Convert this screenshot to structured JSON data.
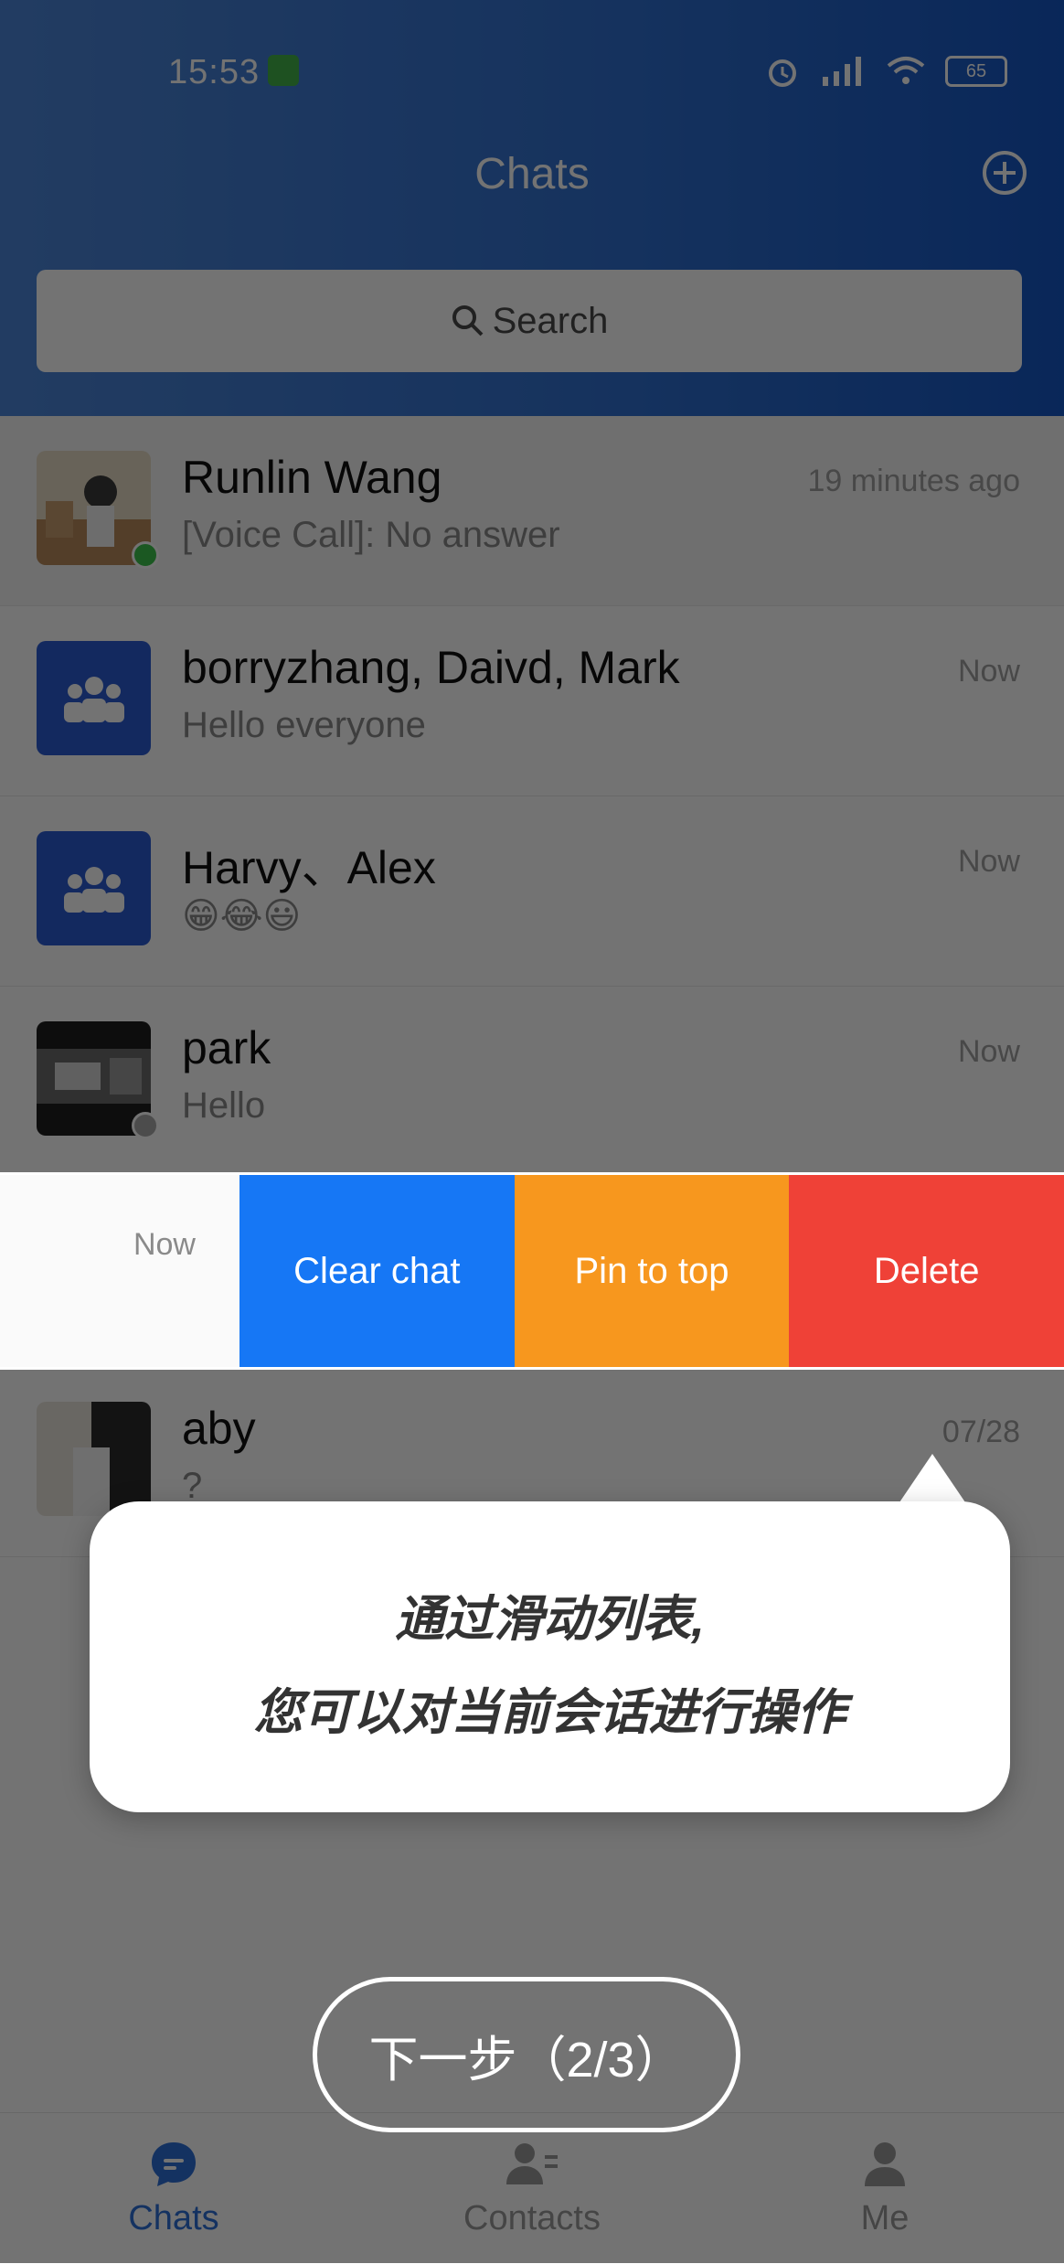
{
  "status_bar": {
    "time": "15:53",
    "battery": "65"
  },
  "header": {
    "title": "Chats"
  },
  "search": {
    "placeholder": "Search"
  },
  "chats": [
    {
      "name": "Runlin Wang",
      "last_message": "[Voice Call]:  No answer",
      "time": "19 minutes ago",
      "presence": "online"
    },
    {
      "name": "borryzhang, Daivd, Mark",
      "last_message": "Hello everyone",
      "time": "Now"
    },
    {
      "name": "Harvy、Alex",
      "last_message": "😁😂😃",
      "time": "Now"
    },
    {
      "name": "park",
      "last_message": "Hello",
      "time": "Now",
      "presence": "offline"
    },
    {
      "name": "aby",
      "last_message": "?",
      "time": "07/28"
    }
  ],
  "swipe_row": {
    "time": "Now",
    "actions": {
      "clear": "Clear chat",
      "pin": "Pin to top",
      "delete": "Delete"
    },
    "colors": {
      "clear": "#1677f5",
      "pin": "#f7971e",
      "delete": "#ef4137"
    }
  },
  "tooltip": {
    "line1": "通过滑动列表,",
    "line2": "您可以对当前会话进行操作"
  },
  "next_button": "下一步（2/3）",
  "tabs": {
    "chats": "Chats",
    "contacts": "Contacts",
    "me": "Me"
  },
  "theme": {
    "accent": "#2d6fd8"
  }
}
